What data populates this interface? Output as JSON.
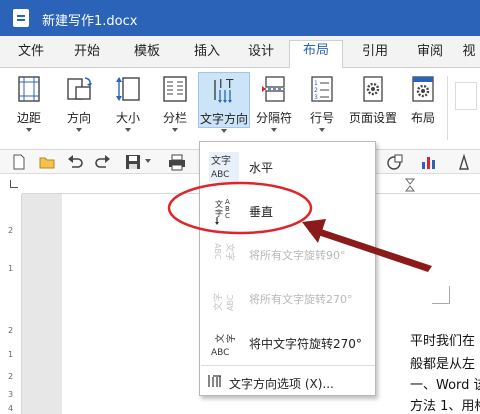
{
  "window": {
    "title": "新建写作1.docx"
  },
  "tabs": [
    "文件",
    "开始",
    "模板",
    "插入",
    "设计",
    "布局",
    "引用",
    "审阅",
    "视"
  ],
  "active_tab": "布局",
  "ribbon": {
    "margins": "边距",
    "orientation": "方向",
    "size": "大小",
    "columns": "分栏",
    "text_direction": "文字方向",
    "breaks": "分隔符",
    "line_numbers": "行号",
    "page_setup": "页面设置",
    "layout": "布局"
  },
  "menu": {
    "items": [
      {
        "label": "水平",
        "icon": "text-horizontal-icon",
        "enabled": true
      },
      {
        "label": "垂直",
        "icon": "text-vertical-icon",
        "enabled": true
      },
      {
        "label": "将所有文字旋转90°",
        "icon": "rotate-90-icon",
        "enabled": false
      },
      {
        "label": "将所有文字旋转270°",
        "icon": "rotate-270-icon",
        "enabled": false
      },
      {
        "label": "将中文字符旋转270°",
        "icon": "rotate-cjk-270-icon",
        "enabled": true
      }
    ],
    "options_label": "文字方向选项 (X)...",
    "options_shortcut": "X"
  },
  "ruler": {
    "numbers": [
      "2",
      "1",
      "2",
      "1",
      "2",
      "3",
      "4"
    ]
  },
  "document": {
    "lines": [
      "平时我们在",
      "般都是从左",
      "一、Word 该",
      "方法 1、用格"
    ]
  },
  "annotation": {
    "colors": {
      "highlight": "#e0242b",
      "arrow": "#8b1a1a"
    }
  }
}
